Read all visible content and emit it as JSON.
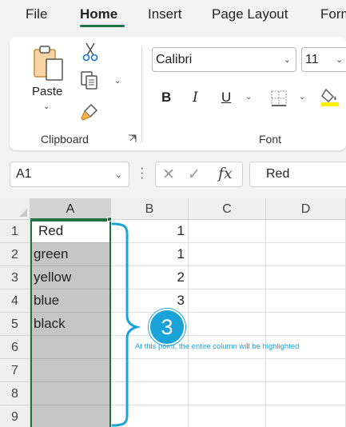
{
  "tabs": [
    {
      "label": "File"
    },
    {
      "label": "Home"
    },
    {
      "label": "Insert"
    },
    {
      "label": "Page Layout"
    },
    {
      "label": "Form"
    }
  ],
  "ribbon": {
    "clipboard": {
      "paste_label": "Paste",
      "group_label": "Clipboard"
    },
    "font": {
      "font_name": "Calibri",
      "font_size": "11",
      "bold": "B",
      "italic": "I",
      "underline": "U",
      "group_label": "Font"
    }
  },
  "formula_bar": {
    "name_box": "A1",
    "cancel": "✕",
    "enter": "✓",
    "fx": "fx",
    "content": "Red"
  },
  "grid": {
    "columns": [
      "A",
      "B",
      "C",
      "D"
    ],
    "rows": [
      "1",
      "2",
      "3",
      "4",
      "5",
      "6",
      "7",
      "8",
      "9"
    ],
    "column_a": [
      "Red",
      "green",
      "yellow",
      "blue",
      "black",
      "",
      "",
      "",
      ""
    ],
    "column_b": [
      "1",
      "1",
      "2",
      "3",
      "",
      "",
      "",
      "",
      ""
    ]
  },
  "annotation": {
    "step_number": "3",
    "text": "At this point, the entire column will be highlighted",
    "color": "#1aa3d8"
  },
  "accent_color": "#217346"
}
